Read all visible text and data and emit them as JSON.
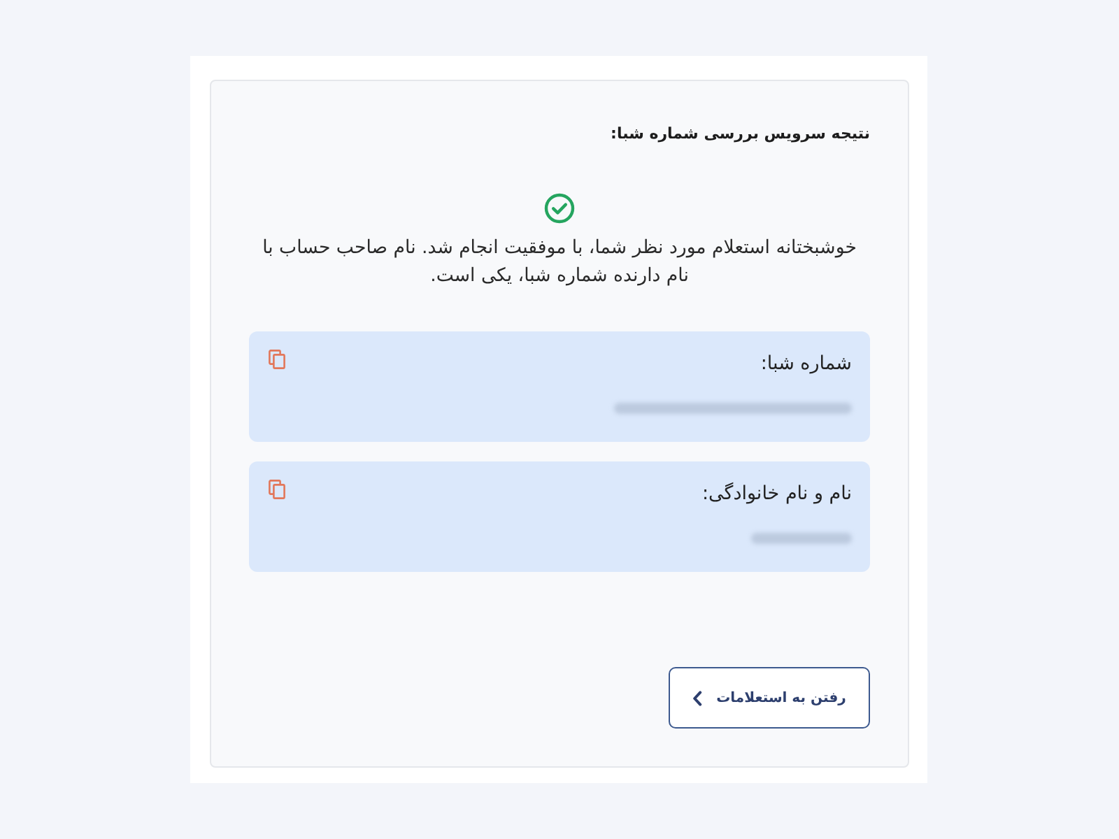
{
  "result": {
    "title": "نتیجه سرویس بررسی شماره شبا:",
    "succeeded": true,
    "message": "خوشبختانه استعلام مورد نظر شما، با موفقیت انجام شد. نام صاحب حساب با نام دارنده شماره شبا، یکی است."
  },
  "fields": [
    {
      "label": "شماره شبا:"
    },
    {
      "label": "نام و نام خانوادگی:"
    }
  ],
  "button": {
    "label": "رفتن به استعلامات"
  }
}
